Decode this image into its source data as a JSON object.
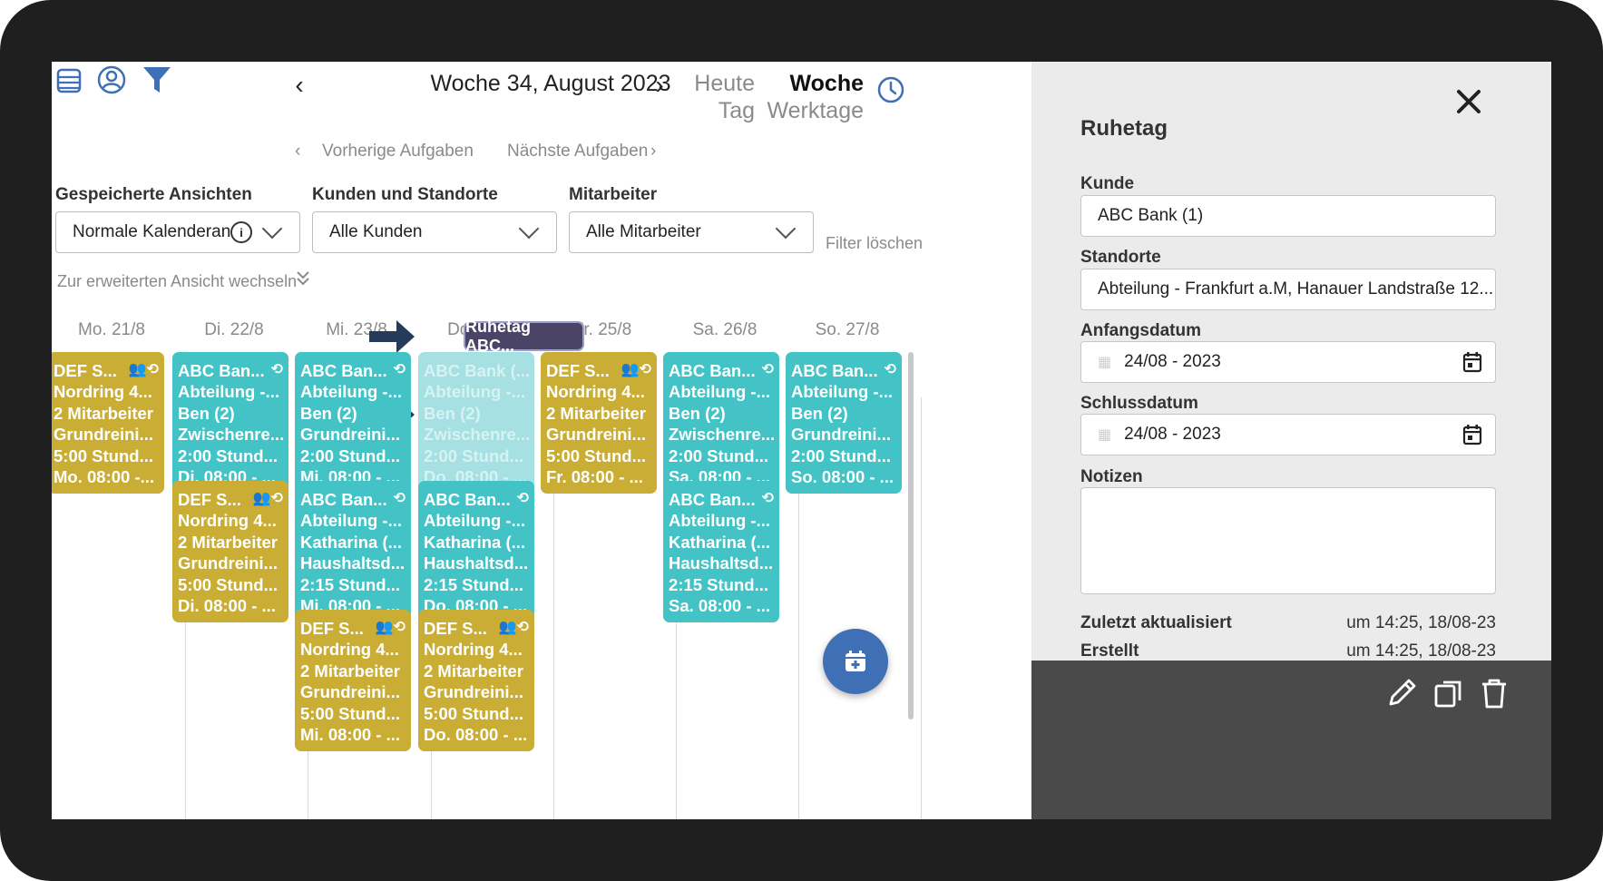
{
  "toolbar": {
    "week_title": "Woche 34, August 2023",
    "view_today": "Heute",
    "view_day": "Tag",
    "view_week": "Woche",
    "view_workdays": "Werktage",
    "prev_tasks": "Vorherige Aufgaben",
    "next_tasks": "Nächste Aufgaben"
  },
  "filters": {
    "saved_views_label": "Gespeicherte Ansichten",
    "saved_views_value": "Normale Kalenderans...",
    "customers_label": "Kunden und Standorte",
    "customers_value": "Alle Kunden",
    "staff_label": "Mitarbeiter",
    "staff_value": "Alle Mitarbeiter",
    "clear": "Filter löschen",
    "advanced_toggle": "Zur erweiterten Ansicht wechseln"
  },
  "days": [
    "Mo. 21/8",
    "Di. 22/8",
    "Mi. 23/8",
    "Do. 24/8",
    "Fr. 25/8",
    "Sa. 26/8",
    "So. 27/8"
  ],
  "rest_day_pill": "Ruhetag ABC...",
  "cards": {
    "def_mo": [
      "DEF S...",
      "Nordring 4...",
      "2 Mitarbeiter",
      "Grundreini...",
      "5:00 Stund...",
      "Mo. 08:00 -..."
    ],
    "def_di": [
      "DEF S...",
      "Nordring 4...",
      "2 Mitarbeiter",
      "Grundreini...",
      "5:00 Stund...",
      "Di. 08:00 - ..."
    ],
    "def_mi": [
      "DEF S...",
      "Nordring 4...",
      "2 Mitarbeiter",
      "Grundreini...",
      "5:00 Stund...",
      "Mi. 08:00 - ..."
    ],
    "def_do": [
      "DEF S...",
      "Nordring 4...",
      "2 Mitarbeiter",
      "Grundreini...",
      "5:00 Stund...",
      "Do. 08:00 - ..."
    ],
    "def_fr": [
      "DEF S...",
      "Nordring 4...",
      "2 Mitarbeiter",
      "Grundreini...",
      "5:00 Stund...",
      "Fr. 08:00 - ..."
    ],
    "abc_ben_di": [
      "ABC Ban...",
      "Abteilung -...",
      "Ben (2)",
      "Zwischenre...",
      "2:00 Stund...",
      "Di. 08:00 - ..."
    ],
    "abc_ben_mi": [
      "ABC Ban...",
      "Abteilung -...",
      "Ben (2)",
      "Grundreini...",
      "2:00 Stund...",
      "Mi. 08:00 - ..."
    ],
    "abc_ben_do": [
      "ABC Bank (...",
      "Abteilung -...",
      "Ben (2)",
      "Zwischenre...",
      "2:00 Stund...",
      "Do. 08:00 - ..."
    ],
    "abc_ben_sa": [
      "ABC Ban...",
      "Abteilung -...",
      "Ben (2)",
      "Zwischenre...",
      "2:00 Stund...",
      "Sa. 08:00 - ..."
    ],
    "abc_ben_so": [
      "ABC Ban...",
      "Abteilung -...",
      "Ben (2)",
      "Grundreini...",
      "2:00 Stund...",
      "So. 08:00 - ..."
    ],
    "abc_kat_mi": [
      "ABC Ban...",
      "Abteilung -...",
      "Katharina (...",
      "Haushaltsd...",
      "2:15 Stund...",
      "Mi. 08:00 - ..."
    ],
    "abc_kat_do": [
      "ABC Ban...",
      "Abteilung -...",
      "Katharina (...",
      "Haushaltsd...",
      "2:15 Stund...",
      "Do. 08:00 - ..."
    ],
    "abc_kat_sa": [
      "ABC Ban...",
      "Abteilung -...",
      "Katharina (...",
      "Haushaltsd...",
      "2:15 Stund...",
      "Sa. 08:00 - ..."
    ]
  },
  "panel": {
    "title": "Ruhetag",
    "customer_label": "Kunde",
    "customer_value": "ABC Bank (1)",
    "locations_label": "Standorte",
    "locations_value": "Abteilung - Frankfurt a.M, Hanauer Landstraße 12...",
    "start_label": "Anfangsdatum",
    "start_value": "24/08 - 2023",
    "end_label": "Schlussdatum",
    "end_value": "24/08 - 2023",
    "notes_label": "Notizen",
    "notes_value": "",
    "updated_label": "Zuletzt aktualisiert",
    "updated_value": "um 14:25, 18/08-23",
    "created_label": "Erstellt",
    "created_value": "um 14:25, 18/08-23"
  },
  "colors": {
    "teal": "#43c3c6",
    "olive": "#c9ad34",
    "faded_teal": "#a7e0e2",
    "pill": "#4a4566",
    "accent_blue": "#3f6fb5",
    "arrow": "#253b5a",
    "footer": "#4a4a4a"
  }
}
